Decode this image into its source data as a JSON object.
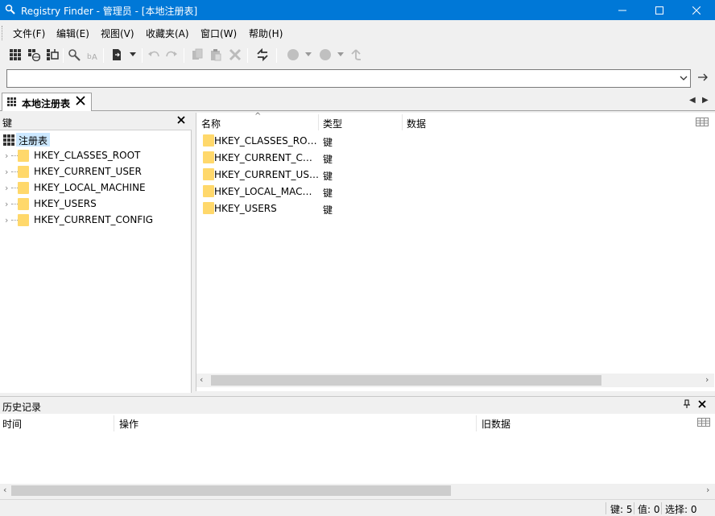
{
  "window": {
    "title": "Registry Finder - 管理员 - [本地注册表]"
  },
  "menu": {
    "items": [
      "文件(F)",
      "编辑(E)",
      "视图(V)",
      "收藏夹(A)",
      "窗口(W)",
      "帮助(H)"
    ]
  },
  "toolbar": {
    "icons": [
      "new-local-registry-icon",
      "new-remote-registry-icon",
      "connect-icon",
      "find-icon",
      "replace-icon",
      "export-icon",
      "undo-icon",
      "redo-icon",
      "copy-icon",
      "paste-icon",
      "delete-icon",
      "refresh-icon",
      "back-icon",
      "forward-icon",
      "up-icon"
    ]
  },
  "search": {
    "value": "",
    "placeholder": ""
  },
  "tabs": [
    {
      "label": "本地注册表"
    }
  ],
  "left_pane": {
    "header": "键",
    "root_label": "注册表",
    "nodes": [
      "HKEY_CLASSES_ROOT",
      "HKEY_CURRENT_USER",
      "HKEY_LOCAL_MACHINE",
      "HKEY_USERS",
      "HKEY_CURRENT_CONFIG"
    ]
  },
  "right_pane": {
    "columns": {
      "name": "名称",
      "type": "类型",
      "data": "数据"
    },
    "rows": [
      {
        "name": "HKEY_CLASSES_ROOT",
        "type": "键"
      },
      {
        "name": "HKEY_CURRENT_CONFIG",
        "type": "键"
      },
      {
        "name": "HKEY_CURRENT_USER",
        "type": "键"
      },
      {
        "name": "HKEY_LOCAL_MACHINE",
        "type": "键"
      },
      {
        "name": "HKEY_USERS",
        "type": "键"
      }
    ]
  },
  "history": {
    "title": "历史记录",
    "columns": {
      "time": "时间",
      "operation": "操作",
      "old_data": "旧数据"
    }
  },
  "status": {
    "keys": "键: 5",
    "values": "值: 0",
    "selected": "选择: 0"
  },
  "colors": {
    "titlebar": "#0078d7",
    "folder": "#ffd86b",
    "selection": "#cce8ff"
  }
}
